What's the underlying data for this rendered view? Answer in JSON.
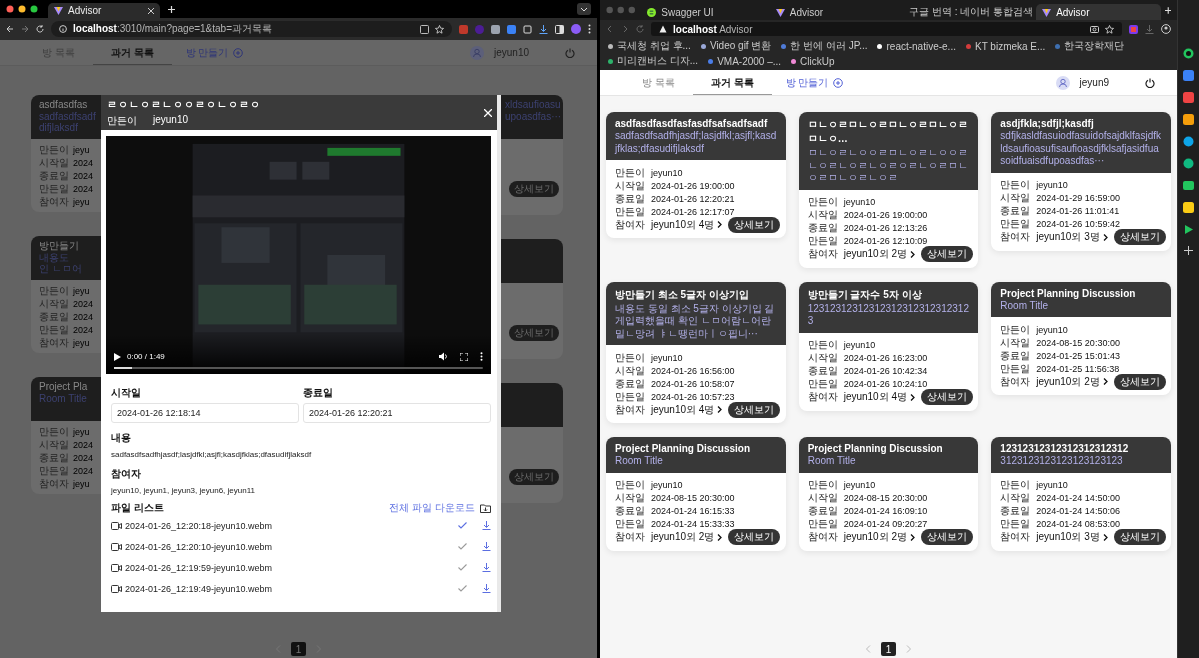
{
  "left_window": {
    "tab": {
      "title": "Advisor"
    },
    "url": {
      "host": "localhost",
      "path": ":3010/main?page=1&tab=과거목록"
    },
    "nav": {
      "tabs": [
        {
          "label": "방 목록",
          "selected": false
        },
        {
          "label": "과거 목록",
          "selected": true
        }
      ],
      "create": "방 만들기",
      "user": "jeyun10"
    },
    "cards_left": [
      {
        "title": "asdfasdfas",
        "desc_lines": [
          "sadfasdfsadf",
          "difjlaksdf"
        ],
        "rows": [
          {
            "label": "만든이",
            "value": "jeyu"
          },
          {
            "label": "시작일",
            "value": "2024"
          },
          {
            "label": "종료일",
            "value": "2024"
          },
          {
            "label": "만든일",
            "value": "2024"
          },
          {
            "label": "참여자",
            "value": "jeyu"
          }
        ]
      },
      {
        "title": "방만들기",
        "desc_lines": [
          "내용도",
          "인 ㄴㅁ어"
        ],
        "rows": [
          {
            "label": "만든이",
            "value": "jeyu"
          },
          {
            "label": "시작일",
            "value": "2024"
          },
          {
            "label": "종료일",
            "value": "2024"
          },
          {
            "label": "만든일",
            "value": "2024"
          },
          {
            "label": "참여자",
            "value": "jeyu"
          }
        ]
      },
      {
        "title": "Project Pla",
        "desc_lines": [
          "Room Title"
        ],
        "rows": [
          {
            "label": "만든이",
            "value": "jeyu"
          },
          {
            "label": "시작일",
            "value": "2024"
          },
          {
            "label": "종료일",
            "value": "2024"
          },
          {
            "label": "만든일",
            "value": "2024"
          },
          {
            "label": "참여자",
            "value": "jeyu"
          }
        ]
      }
    ],
    "cards_right": [
      {
        "desc_lines": [
          "xldsaufioasu",
          "upoasdfas···"
        ],
        "button": "상세보기"
      },
      {
        "button": "상세보기"
      },
      {
        "button": "상세보기"
      }
    ],
    "modal": {
      "title": "ㄹㅇㄴㅇㄹㄴㅇㅇㄹㅇㄴㅇㄹㅇ",
      "creator_label": "만든이",
      "creator": "jeyun10",
      "video": {
        "time": "0:00 / 1:49",
        "level": 0.05
      },
      "start": {
        "label": "시작일",
        "value": "2024-01-26 12:18:14"
      },
      "end": {
        "label": "종료일",
        "value": "2024-01-26 12:20:21"
      },
      "content": {
        "label": "내용",
        "text": "sadfasdfsadfhjasdf;lasjdfkl;asjfl;kasdjfklas;dfasudifjlaksdf"
      },
      "participants": {
        "label": "참여자",
        "text": "jeyun10, jeyun1, jeyun3, jeyun6, jeyun11"
      },
      "files": {
        "label": "파일 리스트",
        "download_all": "전체 파일 다운로드",
        "items": [
          {
            "name": "2024-01-26_12:20:18-jeyun10.webm",
            "checked": true
          },
          {
            "name": "2024-01-26_12:20:10-jeyun10.webm",
            "checked": false
          },
          {
            "name": "2024-01-26_12:19:59-jeyun10.webm",
            "checked": false
          },
          {
            "name": "2024-01-26_12:19:49-jeyun10.webm",
            "checked": false
          }
        ]
      }
    },
    "pages": [
      {
        "label": "1",
        "selected": true
      }
    ]
  },
  "right_window": {
    "tabs": [
      {
        "title": "Swagger UI",
        "kind": "swagger",
        "selected": false
      },
      {
        "title": "Advisor",
        "kind": "advisor",
        "selected": false
      },
      {
        "title": "구글 번역 : 네이버 통합검색",
        "kind": "naver",
        "selected": false
      },
      {
        "title": "Advisor",
        "kind": "advisor",
        "selected": true
      }
    ],
    "url": {
      "host": "localhost",
      "title": "Advisor"
    },
    "bookmarks": [
      {
        "label": "국세청 취업 후...",
        "color": "#bbbbbb"
      },
      {
        "label": "Video gif 변환",
        "color": "#9aa8d8"
      },
      {
        "label": "한 번에 여러 JP...",
        "color": "#4f7bd8"
      },
      {
        "label": "react-native-e...",
        "color": "#ffffff"
      },
      {
        "label": "KT bizmeka E...",
        "color": "#d33b3b"
      },
      {
        "label": "한국장학재단",
        "color": "#3e6fb0"
      },
      {
        "label": "미리캔버스 디자...",
        "color": "#2db36b"
      },
      {
        "label": "VMA-2000 –...",
        "color": "#4a7de8"
      },
      {
        "label": "ClickUp",
        "color": "#f08ad6"
      }
    ],
    "nav": {
      "tabs": [
        {
          "label": "방 목록",
          "selected": false
        },
        {
          "label": "과거 목록",
          "selected": true
        }
      ],
      "create": "방 만들기",
      "user": "jeyun9"
    },
    "cards": [
      {
        "title": "asdfasdfasdfasfasdfsafsadfsadf",
        "desc": "sadfasdfsadfhjasdf;lasjdfkl;asjfl;kasdjfklas;dfasudifjlaksdf",
        "rows": [
          {
            "label": "만든이",
            "value": "jeyun10"
          },
          {
            "label": "시작일",
            "value": "2024-01-26 19:00:00"
          },
          {
            "label": "종료일",
            "value": "2024-01-26 12:20:21"
          },
          {
            "label": "만든일",
            "value": "2024-01-26 12:17:07"
          }
        ],
        "participants": {
          "label": "참여자",
          "value": "jeyun10외 4명"
        },
        "button": "상세보기"
      },
      {
        "title": "ㅁㄴㅇㄹㅁㄴㅇㄹㅁㄴㅇㄹㅁㄴㅇㄹㅁㄴㅇ…",
        "desc": "ㅁㄴㅇㄹㄴㅇㅇㄹㅁㄴㅇㄹㄴㅇㅇㄹㄴㅇㄹㄴㅇㄹㄴㅇㄹㅇㄹㄴㅇㄹㅁㄴㅇㄹㅁㄴㅇㄹㄴㅇㄹ",
        "rows": [
          {
            "label": "만든이",
            "value": "jeyun10"
          },
          {
            "label": "시작일",
            "value": "2024-01-26 19:00:00"
          },
          {
            "label": "종료일",
            "value": "2024-01-26 12:13:26"
          },
          {
            "label": "만든일",
            "value": "2024-01-26 12:10:09"
          }
        ],
        "participants": {
          "label": "참여자",
          "value": "jeyun10외 2명"
        },
        "button": "상세보기"
      },
      {
        "title": "asdjfkla;sdfjl;kasdfj",
        "desc": "sdfjkasldfasuiodfasuidofsajdklfasjdfkldsaufioasufisaufioasdjfklsafjasidfuasoidfuaisdfupoasdfas···",
        "rows": [
          {
            "label": "만든이",
            "value": "jeyun10"
          },
          {
            "label": "시작일",
            "value": "2024-01-29 16:59:00"
          },
          {
            "label": "종료일",
            "value": "2024-01-26 11:01:41"
          },
          {
            "label": "만든일",
            "value": "2024-01-26 10:59:42"
          }
        ],
        "participants": {
          "label": "참여자",
          "value": "jeyun10외 3명"
        },
        "button": "상세보기"
      },
      {
        "title": "방만들기 최소 5글자 이상기입",
        "desc": "내용도 동일 최소 5글자 이상기입 길게입력했을때 확인 ㄴㅁ어람ㄴ어란밀ㄴ망려 ㅑㄴ땡런마ㅣㅇ핍니···",
        "rows": [
          {
            "label": "만든이",
            "value": "jeyun10"
          },
          {
            "label": "시작일",
            "value": "2024-01-26 16:56:00"
          },
          {
            "label": "종료일",
            "value": "2024-01-26 10:58:07"
          },
          {
            "label": "만든일",
            "value": "2024-01-26 10:57:23"
          }
        ],
        "participants": {
          "label": "참여자",
          "value": "jeyun10외 4명"
        },
        "button": "상세보기"
      },
      {
        "title": "방만들기 글자수 5자 이상",
        "desc": "123123123123123123123123123123",
        "rows": [
          {
            "label": "만든이",
            "value": "jeyun10"
          },
          {
            "label": "시작일",
            "value": "2024-01-26 16:23:00"
          },
          {
            "label": "종료일",
            "value": "2024-01-26 10:42:34"
          },
          {
            "label": "만든일",
            "value": "2024-01-26 10:24:10"
          }
        ],
        "participants": {
          "label": "참여자",
          "value": "jeyun10외 4명"
        },
        "button": "상세보기"
      },
      {
        "title": "Project Planning Discussion",
        "desc": "Room Title",
        "rows": [
          {
            "label": "만든이",
            "value": "jeyun10"
          },
          {
            "label": "시작일",
            "value": "2024-08-15 20:30:00"
          },
          {
            "label": "종료일",
            "value": "2024-01-25 15:01:43"
          },
          {
            "label": "만든일",
            "value": "2024-01-25 11:56:38"
          }
        ],
        "participants": {
          "label": "참여자",
          "value": "jeyun10외 2명"
        },
        "button": "상세보기"
      },
      {
        "title": "Project Planning Discussion",
        "desc": "Room Title",
        "rows": [
          {
            "label": "만든이",
            "value": "jeyun10"
          },
          {
            "label": "시작일",
            "value": "2024-08-15 20:30:00"
          },
          {
            "label": "종료일",
            "value": "2024-01-24 16:15:33"
          },
          {
            "label": "만든일",
            "value": "2024-01-24 15:33:33"
          }
        ],
        "participants": {
          "label": "참여자",
          "value": "jeyun10외 2명"
        },
        "button": "상세보기"
      },
      {
        "title": "Project Planning Discussion",
        "desc": "Room Title",
        "rows": [
          {
            "label": "만든이",
            "value": "jeyun10"
          },
          {
            "label": "시작일",
            "value": "2024-08-15 20:30:00"
          },
          {
            "label": "종료일",
            "value": "2024-01-24 16:09:10"
          },
          {
            "label": "만든일",
            "value": "2024-01-24 09:20:27"
          }
        ],
        "participants": {
          "label": "참여자",
          "value": "jeyun10외 2명"
        },
        "button": "상세보기"
      },
      {
        "title": "12312312312312312312312",
        "desc": "3123123123123123123123",
        "rows": [
          {
            "label": "만든이",
            "value": "jeyun10"
          },
          {
            "label": "시작일",
            "value": "2024-01-24 14:50:00"
          },
          {
            "label": "종료일",
            "value": "2024-01-24 14:50:06"
          },
          {
            "label": "만든일",
            "value": "2024-01-24 08:53:00"
          }
        ],
        "participants": {
          "label": "참여자",
          "value": "jeyun10외 3명"
        },
        "button": "상세보기"
      }
    ],
    "pages": [
      {
        "label": "1",
        "selected": true
      }
    ]
  }
}
